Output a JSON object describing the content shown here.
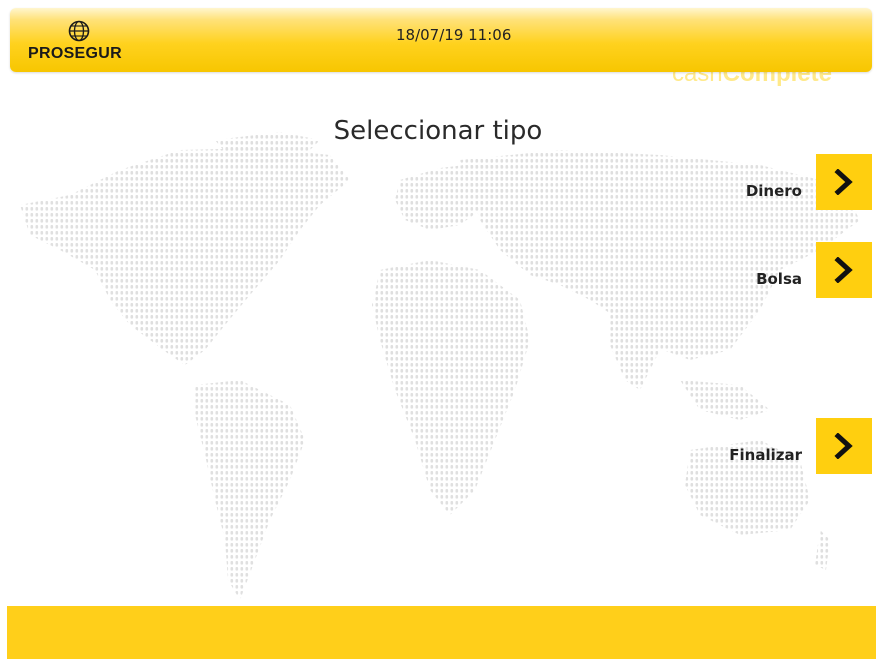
{
  "header": {
    "logo_text": "PROSEGUR",
    "datetime": "18/07/19 11:06"
  },
  "brand_watermark": {
    "light": "cash",
    "bold": "Complete"
  },
  "main": {
    "title": "Seleccionar tipo",
    "options": [
      {
        "label": "Dinero",
        "icon": "chevron-right-icon"
      },
      {
        "label": "Bolsa",
        "icon": "chevron-right-icon"
      },
      {
        "label": "Finalizar",
        "icon": "chevron-right-icon"
      }
    ]
  },
  "colors": {
    "accent_yellow": "#ffcf0f",
    "footer_yellow": "#ffcf1a",
    "text_dark": "#222222"
  }
}
